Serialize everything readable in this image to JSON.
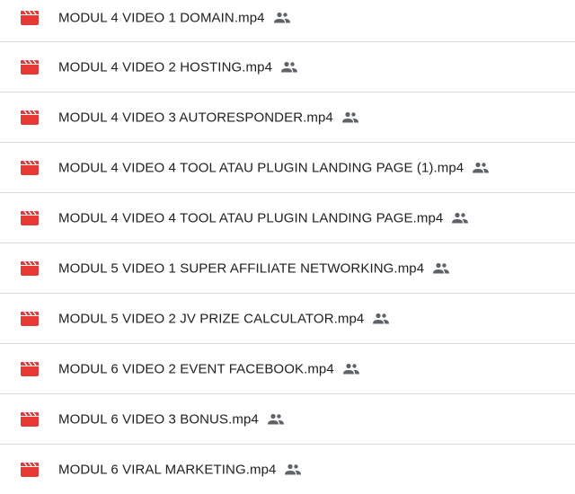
{
  "colors": {
    "video_icon": "#e53935",
    "shared_icon": "#5f6368",
    "text": "#202124",
    "divider": "#dadce0"
  },
  "files": [
    {
      "name": "MODUL 4 VIDEO 1 DOMAIN.mp4",
      "icon": "video-file-icon",
      "shared": true
    },
    {
      "name": "MODUL 4 VIDEO 2 HOSTING.mp4",
      "icon": "video-file-icon",
      "shared": true
    },
    {
      "name": "MODUL 4 VIDEO 3 AUTORESPONDER.mp4",
      "icon": "video-file-icon",
      "shared": true
    },
    {
      "name": "MODUL 4 VIDEO 4 TOOL ATAU PLUGIN LANDING PAGE (1).mp4",
      "icon": "video-file-icon",
      "shared": true
    },
    {
      "name": "MODUL 4 VIDEO 4 TOOL ATAU PLUGIN LANDING PAGE.mp4",
      "icon": "video-file-icon",
      "shared": true
    },
    {
      "name": "MODUL 5 VIDEO 1 SUPER AFFILIATE NETWORKING.mp4",
      "icon": "video-file-icon",
      "shared": true
    },
    {
      "name": "MODUL 5 VIDEO 2 JV PRIZE CALCULATOR.mp4",
      "icon": "video-file-icon",
      "shared": true
    },
    {
      "name": "MODUL 6 VIDEO 2 EVENT FACEBOOK.mp4",
      "icon": "video-file-icon",
      "shared": true
    },
    {
      "name": "MODUL 6 VIDEO 3 BONUS.mp4",
      "icon": "video-file-icon",
      "shared": true
    },
    {
      "name": "MODUL 6 VIRAL MARKETING.mp4",
      "icon": "video-file-icon",
      "shared": true
    }
  ]
}
